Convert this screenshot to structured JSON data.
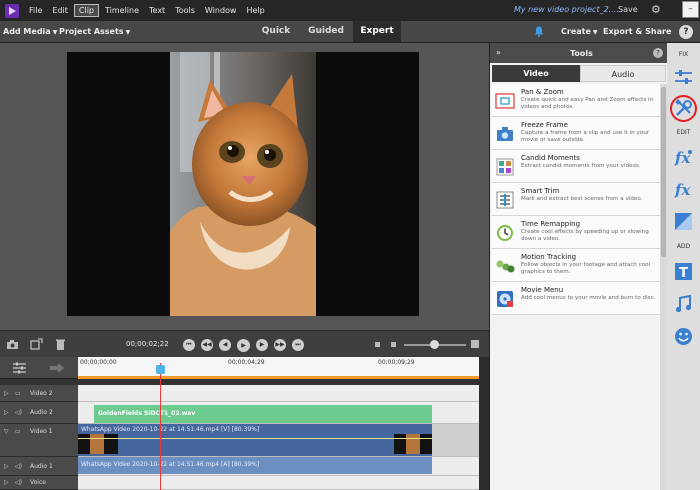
{
  "menu": {
    "items": [
      "File",
      "Edit",
      "Clip",
      "Timeline",
      "Text",
      "Tools",
      "Window",
      "Help"
    ],
    "active": "Clip",
    "project_title": "My new video project_2....",
    "save_label": "Save",
    "minimize_label": "–"
  },
  "toolbar": {
    "add_media": "Add Media",
    "project_assets": "Project Assets",
    "modes": [
      "Quick",
      "Guided",
      "Expert"
    ],
    "active_mode": "Expert",
    "create": "Create",
    "export_share": "Export & Share",
    "help": "?"
  },
  "transport": {
    "timecode": "00;00;02;22"
  },
  "timeline": {
    "ruler_labels": [
      "00;00;00;00",
      "00;00;04;29",
      "00;00;09;29"
    ],
    "tracks": [
      {
        "name": "Video 2",
        "icon": "video-track-icon"
      },
      {
        "name": "Audio 2",
        "icon": "speaker-icon"
      },
      {
        "name": "Video 1",
        "icon": "video-track-icon"
      },
      {
        "name": "Audio 1",
        "icon": "speaker-icon"
      },
      {
        "name": "Voice",
        "icon": "speaker-icon"
      }
    ],
    "audio2_clip": "GoldenFields SIDCT1_02.wav",
    "video1_clip": "WhatsApp Video 2020-10-22 at 14.51.46.mp4 [V] [80.39%]",
    "audio1_clip": "WhatsApp Video 2020-10-22 at 14.51.46.mp4 [A] [80.39%]"
  },
  "tools_panel": {
    "title": "Tools",
    "collapse": "»",
    "help": "?",
    "tabs": [
      "Video",
      "Audio"
    ],
    "active_tab": "Video",
    "tools": [
      {
        "name": "Pan & Zoom",
        "desc": "Create quick and easy Pan and Zoom effects in videos and photos.",
        "icon": "pan-zoom-icon"
      },
      {
        "name": "Freeze Frame",
        "desc": "Capture a frame from a clip and use it in your movie or save outside.",
        "icon": "camera-icon"
      },
      {
        "name": "Candid Moments",
        "desc": "Extract candid moments from your videos.",
        "icon": "candid-moments-icon"
      },
      {
        "name": "Smart Trim",
        "desc": "Mark and extract best scenes from a video.",
        "icon": "smart-trim-icon"
      },
      {
        "name": "Time Remapping",
        "desc": "Create cool effects by speeding up or slowing down a video.",
        "icon": "clock-icon"
      },
      {
        "name": "Motion Tracking",
        "desc": "Follow objects in your footage and attach cool graphics to them.",
        "icon": "motion-tracking-icon"
      },
      {
        "name": "Movie Menu",
        "desc": "Add cool menus to your movie and burn to disc.",
        "icon": "disc-icon"
      }
    ]
  },
  "rail": {
    "fix_label": "FIX",
    "edit_label": "EDIT",
    "add_label": "ADD"
  },
  "colors": {
    "accent_blue": "#4fb3e8",
    "playhead": "#e53a3a",
    "audio2_clip": "#6dcb8f",
    "video_clip": "#46679d",
    "highlight": "#e02020"
  }
}
